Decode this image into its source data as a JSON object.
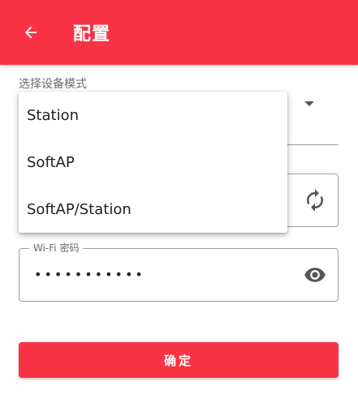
{
  "appbar": {
    "title": "配置"
  },
  "device_mode": {
    "label": "选择设备模式"
  },
  "dropdown": {
    "options": [
      {
        "label": "Station"
      },
      {
        "label": "SoftAP"
      },
      {
        "label": "SoftAP/Station"
      }
    ]
  },
  "password": {
    "label": "Wi-Fi 密码",
    "masked_value": "•••••••••••"
  },
  "confirm": {
    "label": "确定"
  },
  "colors": {
    "primary": "#f93346",
    "icon": "#555555"
  },
  "icons": {
    "back": "arrow-left",
    "refresh": "refresh",
    "visibility": "eye",
    "dropdown": "caret-down"
  }
}
